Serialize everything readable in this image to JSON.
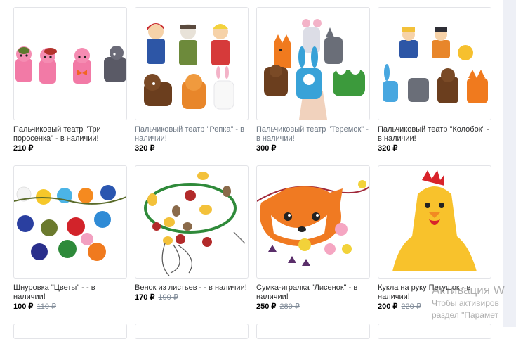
{
  "products": [
    {
      "title": "Пальчиковый театр \"Три поросенка\" - в наличии!",
      "price": "210 ₽",
      "old_price": "",
      "muted": false
    },
    {
      "title": "Пальчиковый театр \"Репка\" - в наличии!",
      "price": "320 ₽",
      "old_price": "",
      "muted": true
    },
    {
      "title": "Пальчиковый театр \"Теремок\" - в наличии!",
      "price": "300 ₽",
      "old_price": "",
      "muted": true
    },
    {
      "title": "Пальчиковый театр \"Колобок\" - в наличии!",
      "price": "320 ₽",
      "old_price": "",
      "muted": false
    },
    {
      "title": "Шнуровка \"Цветы\" - - в наличии!",
      "price": "100 ₽",
      "old_price": "110 ₽",
      "muted": false
    },
    {
      "title": "Венок из листьев - - в наличии!",
      "price": "170 ₽",
      "old_price": "190 ₽",
      "muted": false
    },
    {
      "title": "Сумка-игралка \"Лисенок\" - в наличии!",
      "price": "250 ₽",
      "old_price": "280 ₽",
      "muted": false
    },
    {
      "title": "Кукла на руку Петушок - в наличии!",
      "price": "200 ₽",
      "old_price": "220 ₽",
      "muted": false
    }
  ],
  "watermark": {
    "title": "Активация W",
    "line1": "Чтобы активиров",
    "line2": "раздел \"Парамет"
  }
}
